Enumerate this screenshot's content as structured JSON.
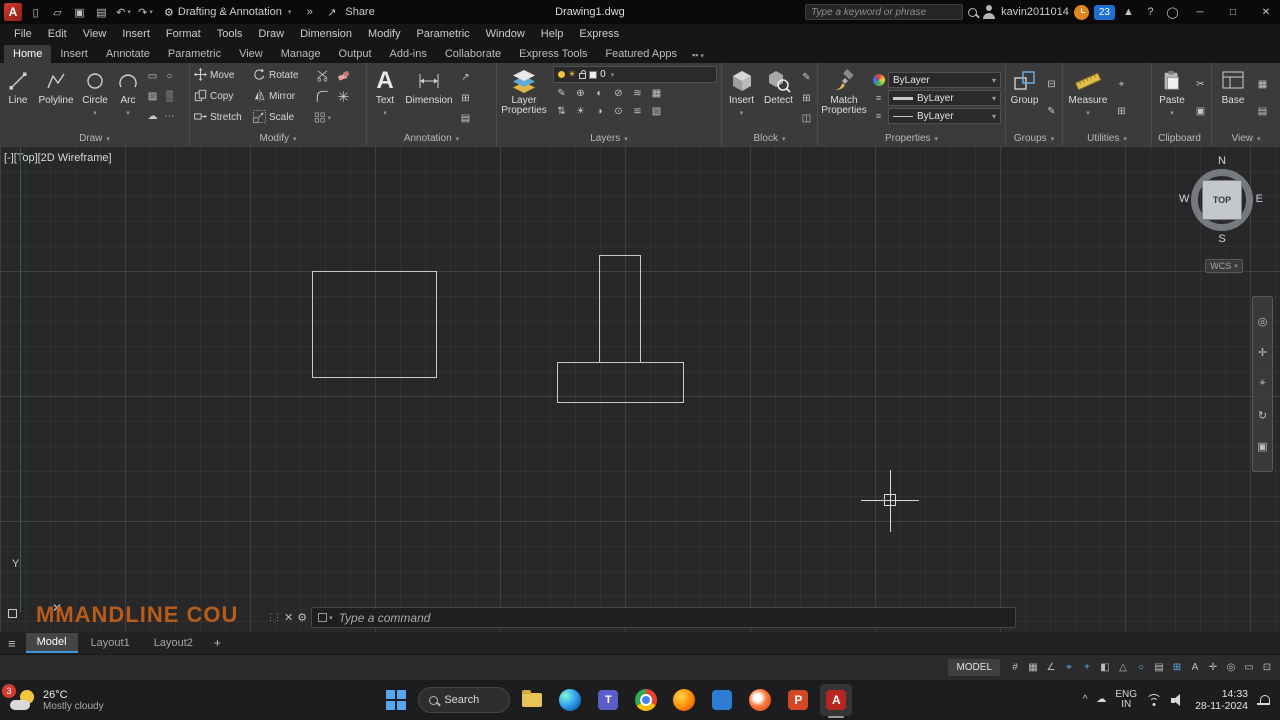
{
  "titlebar": {
    "logo": "A",
    "workspace": "Drafting & Annotation",
    "share": "Share",
    "title": "Drawing1.dwg",
    "search_placeholder": "Type a keyword or phrase",
    "user": "kavin2011014",
    "badge": "23"
  },
  "menubar": {
    "items": [
      "File",
      "Edit",
      "View",
      "Insert",
      "Format",
      "Tools",
      "Draw",
      "Dimension",
      "Modify",
      "Parametric",
      "Window",
      "Help",
      "Express"
    ]
  },
  "ribbon": {
    "tabs": [
      "Home",
      "Insert",
      "Annotate",
      "Parametric",
      "View",
      "Manage",
      "Output",
      "Add-ins",
      "Collaborate",
      "Express Tools",
      "Featured Apps"
    ],
    "draw": {
      "label": "Draw",
      "buttons": [
        "Line",
        "Polyline",
        "Circle",
        "Arc"
      ]
    },
    "modify": {
      "label": "Modify",
      "buttons": [
        "Move",
        "Rotate",
        "Copy",
        "Mirror",
        "Stretch",
        "Scale"
      ]
    },
    "annotation": {
      "label": "Annotation",
      "text": "Text",
      "dimension": "Dimension"
    },
    "layers": {
      "label": "Layers",
      "layer_properties": "Layer Properties",
      "current_layer": "0"
    },
    "block": {
      "label": "Block",
      "insert": "Insert",
      "detect": "Detect"
    },
    "properties": {
      "label": "Properties",
      "match": "Match Properties",
      "color": "ByLayer",
      "lineweight": "ByLayer",
      "linetype": "ByLayer"
    },
    "groups": {
      "label": "Groups",
      "group": "Group"
    },
    "utilities": {
      "label": "Utilities",
      "measure": "Measure"
    },
    "clipboard": {
      "label": "Clipboard",
      "paste": "Paste"
    },
    "view": {
      "label": "View",
      "base": "Base"
    }
  },
  "canvas": {
    "viewport_label": "[-][Top][2D Wireframe]",
    "axis_y_label": "Y",
    "watermark": "MMANDLINE COU",
    "viewcube": {
      "n": "N",
      "e": "E",
      "s": "S",
      "w": "W",
      "face": "TOP",
      "wcs": "WCS"
    }
  },
  "command": {
    "placeholder": "Type a command"
  },
  "layoutbar": {
    "tabs": [
      "Model",
      "Layout1",
      "Layout2"
    ]
  },
  "statusbar": {
    "model": "MODEL",
    "icons": [
      "#",
      "▦",
      "∠",
      "⌖",
      "+",
      "◧",
      "△",
      "○",
      "▤",
      "⊞",
      "A",
      "✛",
      "◎",
      "▭",
      "⊡"
    ]
  },
  "taskbar": {
    "badge": "3",
    "temp": "26°C",
    "condition": "Mostly cloudy",
    "search": "Search",
    "lang1": "ENG",
    "lang2": "IN",
    "time": "14:33",
    "date": "28-11-2024"
  },
  "glyphs": {
    "dropdown": "▾",
    "overflow": "»",
    "gear": "⚙",
    "menu": "≡",
    "plus": "+",
    "close": "✕",
    "minimize": "─",
    "maximize": "□",
    "help": "?",
    "share_arrow": "↗",
    "grip": "⋮⋮",
    "chevron_up": "^",
    "cloud": "☁",
    "sun": "☀",
    "text_icon": "A",
    "autodesk": "▲",
    "circle_icon": "◯",
    "qat": [
      "▯",
      "▱",
      "▣",
      "▤",
      "↶",
      "↷"
    ],
    "draw_tools": [
      "▭",
      "○",
      "▨",
      "▒",
      "☁",
      "⋯"
    ],
    "annotation_tools": [
      "↗",
      "⊞",
      "▤"
    ],
    "layer_tools_row1": [
      "✎",
      "⊕",
      "◐",
      "⊘",
      "≋",
      "▦"
    ],
    "layer_tools_row2": [
      "⇅",
      "☀",
      "◑",
      "⊙",
      "≌",
      "▧"
    ],
    "block_tools": [
      "✎",
      "⊞",
      "◫"
    ],
    "group_tools": [
      "⊟",
      "✎"
    ],
    "utility_tools": [
      "⌖",
      "⊞"
    ],
    "clipboard_tools": [
      "✂",
      "▣"
    ],
    "view_tools": [
      "▦",
      "▤"
    ],
    "nav_tools": [
      "◎",
      "✛",
      "⌖",
      "↻",
      "▣"
    ]
  }
}
